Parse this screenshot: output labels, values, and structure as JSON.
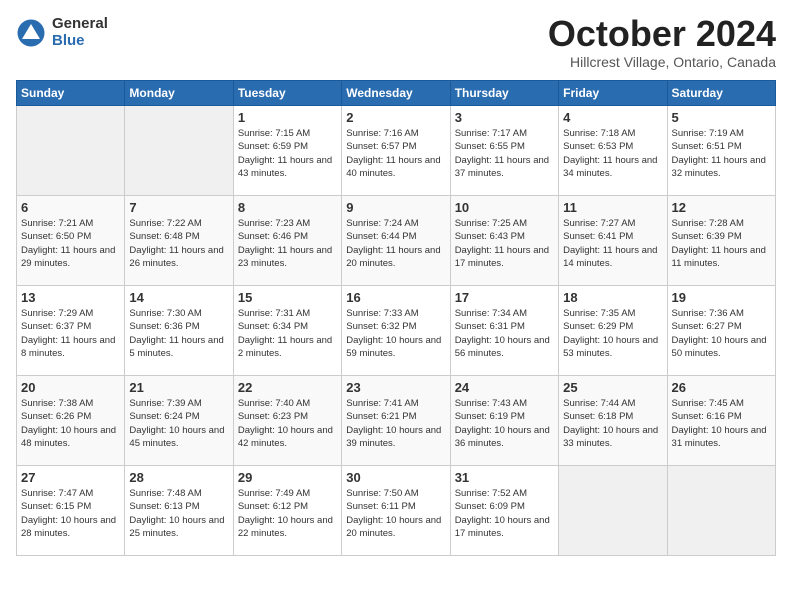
{
  "logo": {
    "general": "General",
    "blue": "Blue"
  },
  "header": {
    "month": "October 2024",
    "location": "Hillcrest Village, Ontario, Canada"
  },
  "days_of_week": [
    "Sunday",
    "Monday",
    "Tuesday",
    "Wednesday",
    "Thursday",
    "Friday",
    "Saturday"
  ],
  "weeks": [
    [
      {
        "day": "",
        "empty": true
      },
      {
        "day": "",
        "empty": true
      },
      {
        "day": "1",
        "sunrise": "Sunrise: 7:15 AM",
        "sunset": "Sunset: 6:59 PM",
        "daylight": "Daylight: 11 hours and 43 minutes."
      },
      {
        "day": "2",
        "sunrise": "Sunrise: 7:16 AM",
        "sunset": "Sunset: 6:57 PM",
        "daylight": "Daylight: 11 hours and 40 minutes."
      },
      {
        "day": "3",
        "sunrise": "Sunrise: 7:17 AM",
        "sunset": "Sunset: 6:55 PM",
        "daylight": "Daylight: 11 hours and 37 minutes."
      },
      {
        "day": "4",
        "sunrise": "Sunrise: 7:18 AM",
        "sunset": "Sunset: 6:53 PM",
        "daylight": "Daylight: 11 hours and 34 minutes."
      },
      {
        "day": "5",
        "sunrise": "Sunrise: 7:19 AM",
        "sunset": "Sunset: 6:51 PM",
        "daylight": "Daylight: 11 hours and 32 minutes."
      }
    ],
    [
      {
        "day": "6",
        "sunrise": "Sunrise: 7:21 AM",
        "sunset": "Sunset: 6:50 PM",
        "daylight": "Daylight: 11 hours and 29 minutes."
      },
      {
        "day": "7",
        "sunrise": "Sunrise: 7:22 AM",
        "sunset": "Sunset: 6:48 PM",
        "daylight": "Daylight: 11 hours and 26 minutes."
      },
      {
        "day": "8",
        "sunrise": "Sunrise: 7:23 AM",
        "sunset": "Sunset: 6:46 PM",
        "daylight": "Daylight: 11 hours and 23 minutes."
      },
      {
        "day": "9",
        "sunrise": "Sunrise: 7:24 AM",
        "sunset": "Sunset: 6:44 PM",
        "daylight": "Daylight: 11 hours and 20 minutes."
      },
      {
        "day": "10",
        "sunrise": "Sunrise: 7:25 AM",
        "sunset": "Sunset: 6:43 PM",
        "daylight": "Daylight: 11 hours and 17 minutes."
      },
      {
        "day": "11",
        "sunrise": "Sunrise: 7:27 AM",
        "sunset": "Sunset: 6:41 PM",
        "daylight": "Daylight: 11 hours and 14 minutes."
      },
      {
        "day": "12",
        "sunrise": "Sunrise: 7:28 AM",
        "sunset": "Sunset: 6:39 PM",
        "daylight": "Daylight: 11 hours and 11 minutes."
      }
    ],
    [
      {
        "day": "13",
        "sunrise": "Sunrise: 7:29 AM",
        "sunset": "Sunset: 6:37 PM",
        "daylight": "Daylight: 11 hours and 8 minutes."
      },
      {
        "day": "14",
        "sunrise": "Sunrise: 7:30 AM",
        "sunset": "Sunset: 6:36 PM",
        "daylight": "Daylight: 11 hours and 5 minutes."
      },
      {
        "day": "15",
        "sunrise": "Sunrise: 7:31 AM",
        "sunset": "Sunset: 6:34 PM",
        "daylight": "Daylight: 11 hours and 2 minutes."
      },
      {
        "day": "16",
        "sunrise": "Sunrise: 7:33 AM",
        "sunset": "Sunset: 6:32 PM",
        "daylight": "Daylight: 10 hours and 59 minutes."
      },
      {
        "day": "17",
        "sunrise": "Sunrise: 7:34 AM",
        "sunset": "Sunset: 6:31 PM",
        "daylight": "Daylight: 10 hours and 56 minutes."
      },
      {
        "day": "18",
        "sunrise": "Sunrise: 7:35 AM",
        "sunset": "Sunset: 6:29 PM",
        "daylight": "Daylight: 10 hours and 53 minutes."
      },
      {
        "day": "19",
        "sunrise": "Sunrise: 7:36 AM",
        "sunset": "Sunset: 6:27 PM",
        "daylight": "Daylight: 10 hours and 50 minutes."
      }
    ],
    [
      {
        "day": "20",
        "sunrise": "Sunrise: 7:38 AM",
        "sunset": "Sunset: 6:26 PM",
        "daylight": "Daylight: 10 hours and 48 minutes."
      },
      {
        "day": "21",
        "sunrise": "Sunrise: 7:39 AM",
        "sunset": "Sunset: 6:24 PM",
        "daylight": "Daylight: 10 hours and 45 minutes."
      },
      {
        "day": "22",
        "sunrise": "Sunrise: 7:40 AM",
        "sunset": "Sunset: 6:23 PM",
        "daylight": "Daylight: 10 hours and 42 minutes."
      },
      {
        "day": "23",
        "sunrise": "Sunrise: 7:41 AM",
        "sunset": "Sunset: 6:21 PM",
        "daylight": "Daylight: 10 hours and 39 minutes."
      },
      {
        "day": "24",
        "sunrise": "Sunrise: 7:43 AM",
        "sunset": "Sunset: 6:19 PM",
        "daylight": "Daylight: 10 hours and 36 minutes."
      },
      {
        "day": "25",
        "sunrise": "Sunrise: 7:44 AM",
        "sunset": "Sunset: 6:18 PM",
        "daylight": "Daylight: 10 hours and 33 minutes."
      },
      {
        "day": "26",
        "sunrise": "Sunrise: 7:45 AM",
        "sunset": "Sunset: 6:16 PM",
        "daylight": "Daylight: 10 hours and 31 minutes."
      }
    ],
    [
      {
        "day": "27",
        "sunrise": "Sunrise: 7:47 AM",
        "sunset": "Sunset: 6:15 PM",
        "daylight": "Daylight: 10 hours and 28 minutes."
      },
      {
        "day": "28",
        "sunrise": "Sunrise: 7:48 AM",
        "sunset": "Sunset: 6:13 PM",
        "daylight": "Daylight: 10 hours and 25 minutes."
      },
      {
        "day": "29",
        "sunrise": "Sunrise: 7:49 AM",
        "sunset": "Sunset: 6:12 PM",
        "daylight": "Daylight: 10 hours and 22 minutes."
      },
      {
        "day": "30",
        "sunrise": "Sunrise: 7:50 AM",
        "sunset": "Sunset: 6:11 PM",
        "daylight": "Daylight: 10 hours and 20 minutes."
      },
      {
        "day": "31",
        "sunrise": "Sunrise: 7:52 AM",
        "sunset": "Sunset: 6:09 PM",
        "daylight": "Daylight: 10 hours and 17 minutes."
      },
      {
        "day": "",
        "empty": true
      },
      {
        "day": "",
        "empty": true
      }
    ]
  ]
}
